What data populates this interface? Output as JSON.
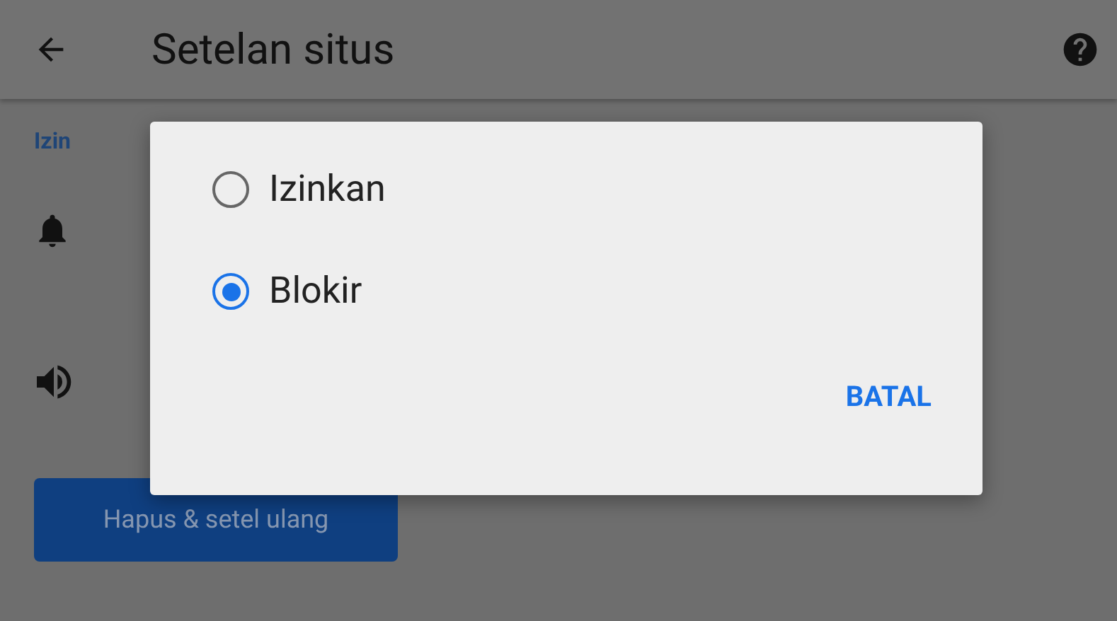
{
  "app_bar": {
    "title": "Setelan situs"
  },
  "section": {
    "label": "Izin"
  },
  "reset_button": {
    "label": "Hapus & setel ulang"
  },
  "dialog": {
    "options": [
      {
        "label": "Izinkan",
        "selected": false
      },
      {
        "label": "Blokir",
        "selected": true
      }
    ],
    "buttons": [
      "BATAL"
    ]
  }
}
